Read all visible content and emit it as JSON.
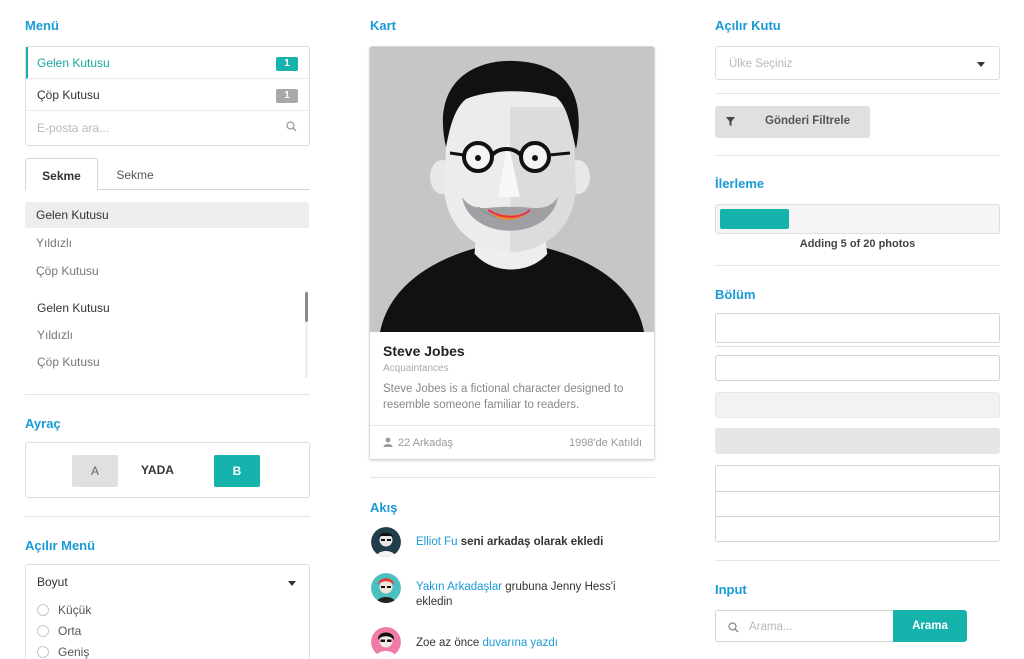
{
  "sections": {
    "menu": "Menü",
    "card": "Kart",
    "dropdown_box": "Açılır Kutu",
    "progress": "İlerleme",
    "divider": "Ayraç",
    "section": "Bölüm",
    "dropdown_menu": "Açılır Menü",
    "feed": "Akış",
    "input": "Input"
  },
  "menu": {
    "items": [
      {
        "label": "Gelen Kutusu",
        "badge": "1",
        "active": true
      },
      {
        "label": "Çöp Kutusu",
        "badge": "1",
        "active": false
      }
    ],
    "search_placeholder": "E-posta ara..."
  },
  "tabs": {
    "items": [
      "Sekme",
      "Sekme"
    ],
    "active_index": 0,
    "list": [
      "Gelen Kutusu",
      "Yıldızlı",
      "Çöp Kutusu"
    ],
    "selected_index": 0
  },
  "scroll_list": [
    "Gelen Kutusu",
    "Yıldızlı",
    "Çöp Kutusu"
  ],
  "divider": {
    "a": "A",
    "or": "YADA",
    "b": "B"
  },
  "dropdown_menu": {
    "title": "Boyut",
    "options": [
      "Küçük",
      "Orta",
      "Geniş"
    ]
  },
  "card": {
    "name": "Steve Jobes",
    "meta": "Acquaintances",
    "description": "Steve Jobes is a fictional character designed to resemble someone familiar to readers.",
    "friends": "22 Arkadaş",
    "joined": "1998'de Katıldı"
  },
  "feed": [
    {
      "link": "Elliot Fu",
      "strong": " seni arkadaş olarak ekledi",
      "text": ""
    },
    {
      "link": "Yakın Arkadaşlar",
      "text": " grubuna Jenny Hess'i ekledin",
      "strong": ""
    },
    {
      "pre": "Zoe az önce ",
      "link": "duvarına yazdı"
    }
  ],
  "dropdown_box": {
    "placeholder": "Ülke Seçiniz"
  },
  "filter_button": "Gönderi Filtrele",
  "progress": {
    "label": "Adding 5 of 20 photos",
    "value": 0.25
  },
  "input": {
    "placeholder": "Arama...",
    "button": "Arama"
  },
  "colors": {
    "accent": "#16b3ac",
    "heading": "#1a9ad6"
  }
}
